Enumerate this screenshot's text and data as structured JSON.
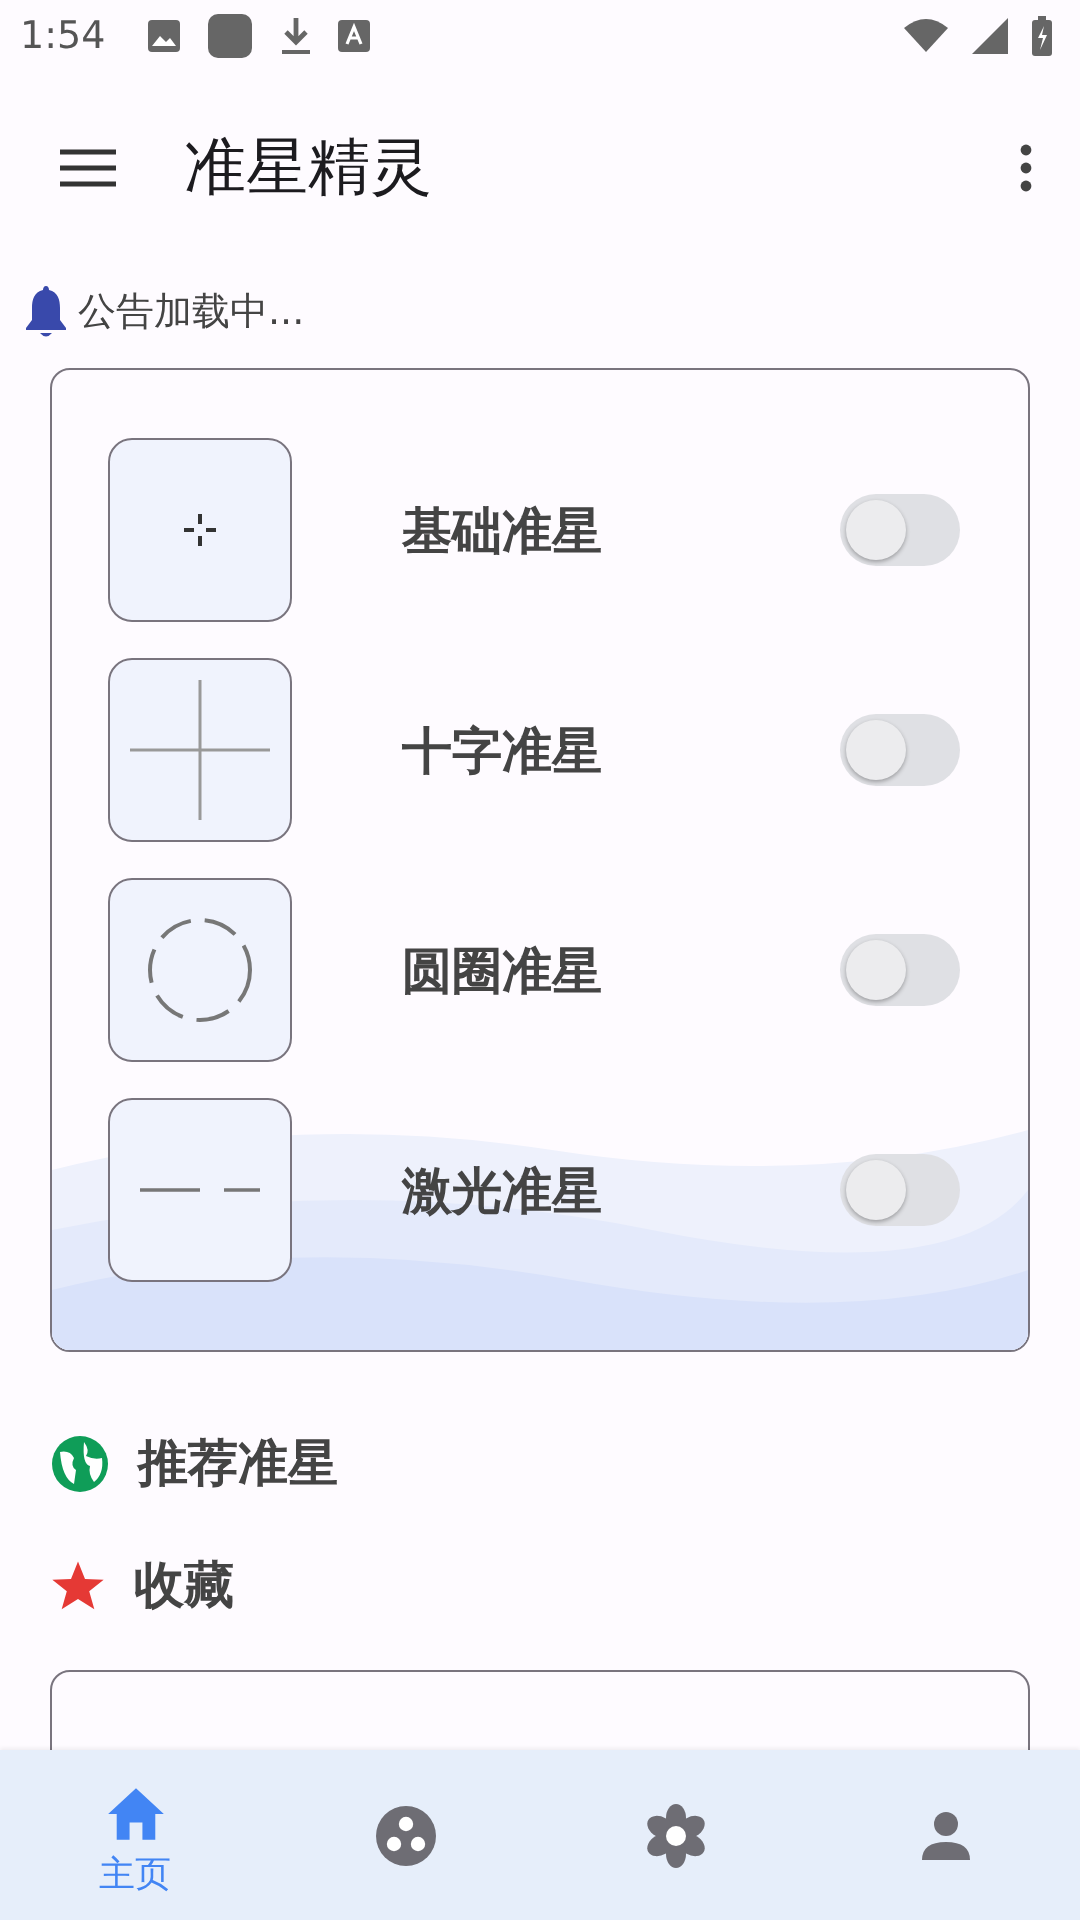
{
  "status_bar": {
    "time": "1:54"
  },
  "app_bar": {
    "title": "准星精灵"
  },
  "notice": {
    "text": "公告加载中..."
  },
  "crosshairs": [
    {
      "kind": "dot",
      "label": "基础准星",
      "on": false
    },
    {
      "kind": "cross",
      "label": "十字准星",
      "on": false
    },
    {
      "kind": "circle",
      "label": "圆圈准星",
      "on": false
    },
    {
      "kind": "dashed",
      "label": "激光准星",
      "on": false
    }
  ],
  "sections": [
    {
      "kind": "globe",
      "label": "推荐准星"
    },
    {
      "kind": "star",
      "label": "收藏"
    }
  ],
  "bottom_nav": [
    {
      "kind": "home",
      "label": "主页",
      "selected": true
    },
    {
      "kind": "dots",
      "selected": false
    },
    {
      "kind": "flower",
      "selected": false
    },
    {
      "kind": "person",
      "selected": false
    }
  ]
}
